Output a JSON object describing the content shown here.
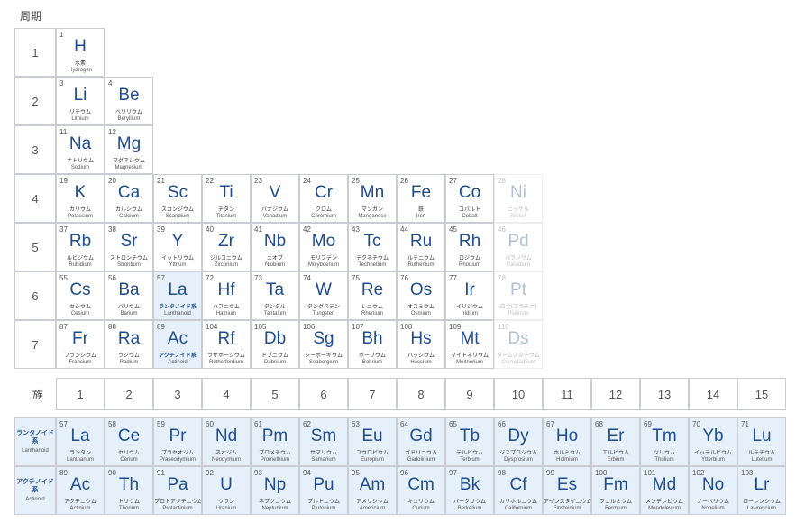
{
  "period_title": "周期",
  "group_label": "族",
  "periods": [
    "1",
    "2",
    "3",
    "4",
    "5",
    "6",
    "7"
  ],
  "groups": [
    "1",
    "2",
    "3",
    "4",
    "5",
    "6",
    "7",
    "8",
    "9",
    "10",
    "11",
    "12",
    "13",
    "14",
    "15"
  ],
  "lanthanoid_label": {
    "jp": "ランタノイド系",
    "en": "Lanthanoid"
  },
  "actinoid_label": {
    "jp": "アクチノイド系",
    "en": "Actinoid"
  },
  "main": [
    {
      "n": "1",
      "s": "H",
      "jp": "水素",
      "en": "Hydrogen",
      "r": 0,
      "c": 0
    },
    {
      "n": "3",
      "s": "Li",
      "jp": "リチウム",
      "en": "Lithium",
      "r": 1,
      "c": 0
    },
    {
      "n": "4",
      "s": "Be",
      "jp": "ベリリウム",
      "en": "Beryllium",
      "r": 1,
      "c": 1
    },
    {
      "n": "11",
      "s": "Na",
      "jp": "ナトリウム",
      "en": "Sodium",
      "r": 2,
      "c": 0
    },
    {
      "n": "12",
      "s": "Mg",
      "jp": "マグネシウム",
      "en": "Magnesium",
      "r": 2,
      "c": 1
    },
    {
      "n": "19",
      "s": "K",
      "jp": "カリウム",
      "en": "Potassium",
      "r": 3,
      "c": 0
    },
    {
      "n": "20",
      "s": "Ca",
      "jp": "カルシウム",
      "en": "Calcium",
      "r": 3,
      "c": 1
    },
    {
      "n": "21",
      "s": "Sc",
      "jp": "スカンジウム",
      "en": "Scandium",
      "r": 3,
      "c": 2
    },
    {
      "n": "22",
      "s": "Ti",
      "jp": "チタン",
      "en": "Titanium",
      "r": 3,
      "c": 3
    },
    {
      "n": "23",
      "s": "V",
      "jp": "バナジウム",
      "en": "Vanadium",
      "r": 3,
      "c": 4
    },
    {
      "n": "24",
      "s": "Cr",
      "jp": "クロム",
      "en": "Chromium",
      "r": 3,
      "c": 5
    },
    {
      "n": "25",
      "s": "Mn",
      "jp": "マンガン",
      "en": "Manganese",
      "r": 3,
      "c": 6
    },
    {
      "n": "26",
      "s": "Fe",
      "jp": "鉄",
      "en": "Iron",
      "r": 3,
      "c": 7
    },
    {
      "n": "27",
      "s": "Co",
      "jp": "コバルト",
      "en": "Cobalt",
      "r": 3,
      "c": 8
    },
    {
      "n": "28",
      "s": "Ni",
      "jp": "ニッケル",
      "en": "Nickel",
      "r": 3,
      "c": 9,
      "fade": true
    },
    {
      "n": "37",
      "s": "Rb",
      "jp": "ルビジウム",
      "en": "Rubidium",
      "r": 4,
      "c": 0
    },
    {
      "n": "38",
      "s": "Sr",
      "jp": "ストロンチウム",
      "en": "Strontium",
      "r": 4,
      "c": 1
    },
    {
      "n": "39",
      "s": "Y",
      "jp": "イットリウム",
      "en": "Yttrium",
      "r": 4,
      "c": 2
    },
    {
      "n": "40",
      "s": "Zr",
      "jp": "ジルコニウム",
      "en": "Zirconium",
      "r": 4,
      "c": 3
    },
    {
      "n": "41",
      "s": "Nb",
      "jp": "ニオブ",
      "en": "Niobium",
      "r": 4,
      "c": 4
    },
    {
      "n": "42",
      "s": "Mo",
      "jp": "モリブデン",
      "en": "Molybdenum",
      "r": 4,
      "c": 5
    },
    {
      "n": "43",
      "s": "Tc",
      "jp": "テクネチウム",
      "en": "Technetium",
      "r": 4,
      "c": 6
    },
    {
      "n": "44",
      "s": "Ru",
      "jp": "ルテニウム",
      "en": "Ruthenium",
      "r": 4,
      "c": 7
    },
    {
      "n": "45",
      "s": "Rh",
      "jp": "ロジウム",
      "en": "Rhodium",
      "r": 4,
      "c": 8
    },
    {
      "n": "46",
      "s": "Pd",
      "jp": "パラジウム",
      "en": "Palladium",
      "r": 4,
      "c": 9,
      "fade": true
    },
    {
      "n": "55",
      "s": "Cs",
      "jp": "セシウム",
      "en": "Cesium",
      "r": 5,
      "c": 0
    },
    {
      "n": "56",
      "s": "Ba",
      "jp": "バリウム",
      "en": "Barium",
      "r": 5,
      "c": 1
    },
    {
      "n": "57",
      "s": "La",
      "jp": "ランタノイド系",
      "en": "Lanthanoid",
      "r": 5,
      "c": 2,
      "series": true
    },
    {
      "n": "72",
      "s": "Hf",
      "jp": "ハフニウム",
      "en": "Hafnium",
      "r": 5,
      "c": 3
    },
    {
      "n": "73",
      "s": "Ta",
      "jp": "タンタル",
      "en": "Tantalum",
      "r": 5,
      "c": 4
    },
    {
      "n": "74",
      "s": "W",
      "jp": "タングステン",
      "en": "Tungsten",
      "r": 5,
      "c": 5
    },
    {
      "n": "75",
      "s": "Re",
      "jp": "レニウム",
      "en": "Rhenium",
      "r": 5,
      "c": 6
    },
    {
      "n": "76",
      "s": "Os",
      "jp": "オスミウム",
      "en": "Osmium",
      "r": 5,
      "c": 7
    },
    {
      "n": "77",
      "s": "Ir",
      "jp": "イリジウム",
      "en": "Iridium",
      "r": 5,
      "c": 8
    },
    {
      "n": "78",
      "s": "Pt",
      "jp": "白金(プラチナ)",
      "en": "Platinum",
      "r": 5,
      "c": 9,
      "fade": true
    },
    {
      "n": "87",
      "s": "Fr",
      "jp": "フランシウム",
      "en": "Francium",
      "r": 6,
      "c": 0
    },
    {
      "n": "88",
      "s": "Ra",
      "jp": "ラジウム",
      "en": "Radium",
      "r": 6,
      "c": 1
    },
    {
      "n": "89",
      "s": "Ac",
      "jp": "アクチノイド系",
      "en": "Actinoid",
      "r": 6,
      "c": 2,
      "series": true
    },
    {
      "n": "104",
      "s": "Rf",
      "jp": "ラザホージウム",
      "en": "Rutherfordium",
      "r": 6,
      "c": 3
    },
    {
      "n": "105",
      "s": "Db",
      "jp": "ドブニウム",
      "en": "Dubnium",
      "r": 6,
      "c": 4
    },
    {
      "n": "106",
      "s": "Sg",
      "jp": "シーボーギウム",
      "en": "Seaborgium",
      "r": 6,
      "c": 5
    },
    {
      "n": "107",
      "s": "Bh",
      "jp": "ボーリウム",
      "en": "Bohrium",
      "r": 6,
      "c": 6
    },
    {
      "n": "108",
      "s": "Hs",
      "jp": "ハッシウム",
      "en": "Hassium",
      "r": 6,
      "c": 7
    },
    {
      "n": "109",
      "s": "Mt",
      "jp": "マイトネリウム",
      "en": "Meitnerium",
      "r": 6,
      "c": 8
    },
    {
      "n": "110",
      "s": "Ds",
      "jp": "ダームスタチウム",
      "en": "Darmstadtium",
      "r": 6,
      "c": 9,
      "fade": true
    }
  ],
  "lanthanoids": [
    {
      "n": "57",
      "s": "La",
      "jp": "ランタン",
      "en": "Lanthanum"
    },
    {
      "n": "58",
      "s": "Ce",
      "jp": "セリウム",
      "en": "Cerium"
    },
    {
      "n": "59",
      "s": "Pr",
      "jp": "プラセオジム",
      "en": "Praseodymium"
    },
    {
      "n": "60",
      "s": "Nd",
      "jp": "ネオジム",
      "en": "Neodymium"
    },
    {
      "n": "61",
      "s": "Pm",
      "jp": "プロメチウム",
      "en": "Promethium"
    },
    {
      "n": "62",
      "s": "Sm",
      "jp": "サマリウム",
      "en": "Samarium"
    },
    {
      "n": "63",
      "s": "Eu",
      "jp": "ユウロピウム",
      "en": "Europium"
    },
    {
      "n": "64",
      "s": "Gd",
      "jp": "ガドリニウム",
      "en": "Gadolinium"
    },
    {
      "n": "65",
      "s": "Tb",
      "jp": "テルビウム",
      "en": "Terbium"
    },
    {
      "n": "66",
      "s": "Dy",
      "jp": "ジスプロシウム",
      "en": "Dysprosium"
    },
    {
      "n": "67",
      "s": "Ho",
      "jp": "ホルミウム",
      "en": "Holmium"
    },
    {
      "n": "68",
      "s": "Er",
      "jp": "エルビウム",
      "en": "Erbium"
    },
    {
      "n": "69",
      "s": "Tm",
      "jp": "ツリウム",
      "en": "Thulium"
    },
    {
      "n": "70",
      "s": "Yb",
      "jp": "イッテルビウム",
      "en": "Ytterbium"
    },
    {
      "n": "71",
      "s": "Lu",
      "jp": "ルテチウム",
      "en": "Lutetium"
    }
  ],
  "actinoids": [
    {
      "n": "89",
      "s": "Ac",
      "jp": "アクチニウム",
      "en": "Actinium"
    },
    {
      "n": "90",
      "s": "Th",
      "jp": "トリウム",
      "en": "Thorium"
    },
    {
      "n": "91",
      "s": "Pa",
      "jp": "プロトアクチニウム",
      "en": "Protactinium"
    },
    {
      "n": "92",
      "s": "U",
      "jp": "ウラン",
      "en": "Uranium"
    },
    {
      "n": "93",
      "s": "Np",
      "jp": "ネプツニウム",
      "en": "Neptunium"
    },
    {
      "n": "94",
      "s": "Pu",
      "jp": "プルトニウム",
      "en": "Plutonium"
    },
    {
      "n": "95",
      "s": "Am",
      "jp": "アメリシウム",
      "en": "Americium"
    },
    {
      "n": "96",
      "s": "Cm",
      "jp": "キュリウム",
      "en": "Curium"
    },
    {
      "n": "97",
      "s": "Bk",
      "jp": "バークリウム",
      "en": "Berkelium"
    },
    {
      "n": "98",
      "s": "Cf",
      "jp": "カリホルニウム",
      "en": "Californium"
    },
    {
      "n": "99",
      "s": "Es",
      "jp": "アインスタイニウム",
      "en": "Einsteinium"
    },
    {
      "n": "100",
      "s": "Fm",
      "jp": "フェルミウム",
      "en": "Fermium"
    },
    {
      "n": "101",
      "s": "Md",
      "jp": "メンデレビウム",
      "en": "Mendelevium"
    },
    {
      "n": "102",
      "s": "No",
      "jp": "ノーベリウム",
      "en": "Nobelium"
    },
    {
      "n": "103",
      "s": "Lr",
      "jp": "ローレンシウム",
      "en": "Lawrencium"
    }
  ]
}
